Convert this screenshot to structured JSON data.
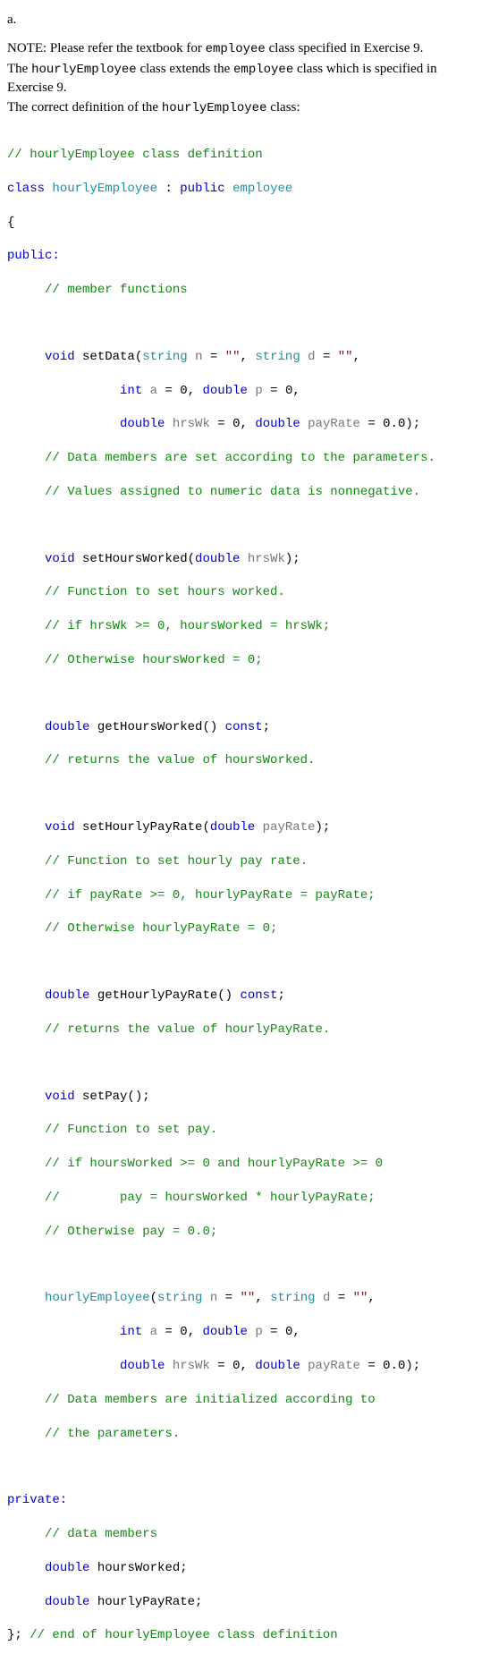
{
  "intro": {
    "label_a": "a.",
    "note_prefix": "NOTE: Please refer the textbook for ",
    "note_code1": "employee",
    "note_suffix1": " class specified in Exercise 9.",
    "line2_prefix": "The ",
    "line2_code1": "hourlyEmployee",
    "line2_mid": " class extends the ",
    "line2_code2": "employee",
    "line2_suffix": " class which is specified in Exercise 9.",
    "line3_prefix": "The correct definition of the ",
    "line3_code1": "hourlyEmployee",
    "line3_suffix": " class:"
  },
  "code": {
    "c1": "// hourlyEmployee class definition",
    "kw_class": "class",
    "tok_hourlyEmployee": "hourlyEmployee",
    "colon_space": " : ",
    "kw_public": "public",
    "tok_employee": "employee",
    "brace_open": "{",
    "public_colon": "public:",
    "c_member_functions": "// member functions",
    "kw_void": "void",
    "fn_setData": " setData(",
    "tok_string": "string",
    "param_n": " n",
    "eq_sp": " = ",
    "empty_str": "\"\"",
    "comma_sp": ", ",
    "param_d": " d",
    "kw_int": "int",
    "param_a": " a",
    "zero": "0",
    "kw_double": "double",
    "param_p": " p",
    "param_hrsWk": " hrsWk",
    "param_payRate": " payRate",
    "zero_f": "0.0",
    "paren_close_semi": ");",
    "c_setData1": "// Data members are set according to the parameters.",
    "c_setData2": "// Values assigned to numeric data is nonnegative.",
    "fn_setHoursWorked": " setHoursWorked(",
    "c_shw1": "// Function to set hours worked.",
    "c_shw2": "// if hrsWk >= 0, hoursWorked = hrsWk;",
    "c_shw3": "// Otherwise hoursWorked = 0;",
    "fn_getHoursWorked": " getHoursWorked() ",
    "kw_const": "const",
    "semi": ";",
    "c_ghw": "// returns the value of hoursWorked.",
    "fn_setHourlyPayRate": " setHourlyPayRate(",
    "c_shpr1": "// Function to set hourly pay rate.",
    "c_shpr2": "// if payRate >= 0, hourlyPayRate = payRate;",
    "c_shpr3": "// Otherwise hourlyPayRate = 0;",
    "fn_getHourlyPayRate": " getHourlyPayRate() ",
    "c_ghpr": "// returns the value of hourlyPayRate.",
    "fn_setPay": " setPay();",
    "c_sp1": "// Function to set pay.",
    "c_sp2": "// if hoursWorked >= 0 and hourlyPayRate >= 0",
    "c_sp3": "//        pay = hoursWorked * hourlyPayRate;",
    "c_sp4": "// Otherwise pay = 0.0;",
    "ctor_open": "(",
    "c_ctor1": "// Data members are initialized according to",
    "c_ctor2": "// the parameters.",
    "private_colon": "private:",
    "c_data_members": "// data members",
    "member_hoursWorked": " hoursWorked;",
    "member_hourlyPayRate": " hourlyPayRate;",
    "brace_close_semi": "}; ",
    "c_end": "// end of hourlyEmployee class definition"
  },
  "indent": {
    "i1": "     ",
    "i2": "               "
  }
}
